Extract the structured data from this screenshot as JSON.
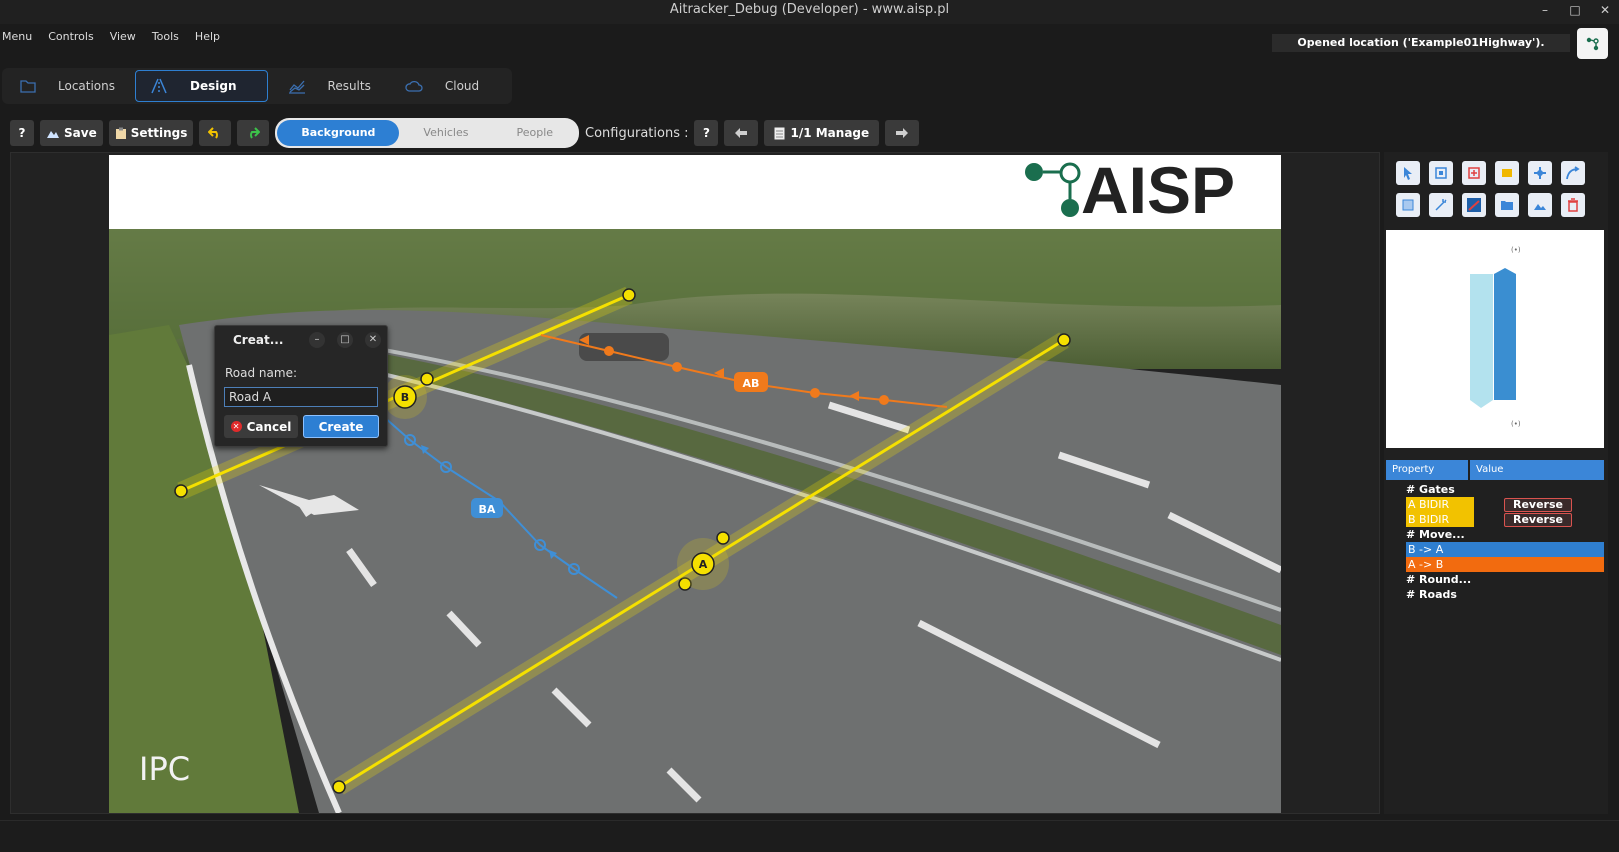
{
  "window": {
    "title": "Aitracker_Debug (Developer) - www.aisp.pl",
    "buttons": [
      "–",
      "□",
      "✕"
    ]
  },
  "menu": [
    "Menu",
    "Controls",
    "View",
    "Tools",
    "Help"
  ],
  "status_message": "Opened location ('Example01Highway').",
  "main_tabs": [
    {
      "label": "Locations",
      "icon": "folder-icon"
    },
    {
      "label": "Design",
      "icon": "design-icon"
    },
    {
      "label": "Results",
      "icon": "chart-icon"
    },
    {
      "label": "Cloud",
      "icon": "cloud-icon"
    }
  ],
  "toolbar": {
    "help_label": "?",
    "save_label": "Save",
    "settings_label": "Settings",
    "modes": [
      "Background",
      "Vehicles",
      "People"
    ],
    "active_mode": "Background",
    "configurations_label": "Configurations :",
    "config_help": "?",
    "manage_label": "1/1 Manage"
  },
  "canvas": {
    "logo_text": "AISP",
    "watermark": "IPC",
    "gate_a": "A",
    "gate_b": "B",
    "movement_ab": "AB",
    "movement_ba": "BA",
    "colors": {
      "gate": "#f5e000",
      "movement_ab": "#f07a1c",
      "movement_ba": "#3f8fd6"
    }
  },
  "dialog": {
    "title": "Creat...",
    "field_label": "Road name:",
    "field_value": "Road A",
    "cancel_label": "Cancel",
    "create_label": "Create"
  },
  "properties": {
    "headers": [
      "Property",
      "Value"
    ],
    "gates_header": "# Gates",
    "gates": [
      {
        "name": "A BIDIR",
        "value": "Reverse"
      },
      {
        "name": "B BIDIR",
        "value": "Reverse"
      }
    ],
    "moves_header": "# Move...",
    "moves": [
      {
        "name": "B -> A",
        "color": "#2f7fd0"
      },
      {
        "name": "A -> B",
        "color": "#f26b0f"
      }
    ],
    "round_header": "# Round...",
    "roads_header": "# Roads"
  }
}
